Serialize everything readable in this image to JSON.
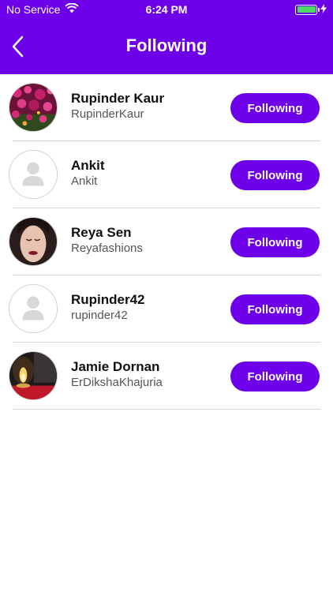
{
  "status_bar": {
    "carrier": "No Service",
    "time": "6:24 PM",
    "battery_level": 1.0
  },
  "header": {
    "title": "Following",
    "back_icon": "chevron-left-icon"
  },
  "colors": {
    "primary": "#6d00e8",
    "battery": "#4cd964"
  },
  "users": [
    {
      "name": "Rupinder Kaur",
      "username": "RupinderKaur",
      "button_label": "Following",
      "avatar": "flowers-photo"
    },
    {
      "name": "Ankit",
      "username": "Ankit",
      "button_label": "Following",
      "avatar": "default-person-icon"
    },
    {
      "name": "Reya Sen",
      "username": "Reyafashions",
      "button_label": "Following",
      "avatar": "portrait-photo"
    },
    {
      "name": "Rupinder42",
      "username": "rupinder42",
      "button_label": "Following",
      "avatar": "default-person-icon"
    },
    {
      "name": "Jamie Dornan",
      "username": "ErDikshaKhajuria",
      "button_label": "Following",
      "avatar": "candle-photo"
    }
  ]
}
